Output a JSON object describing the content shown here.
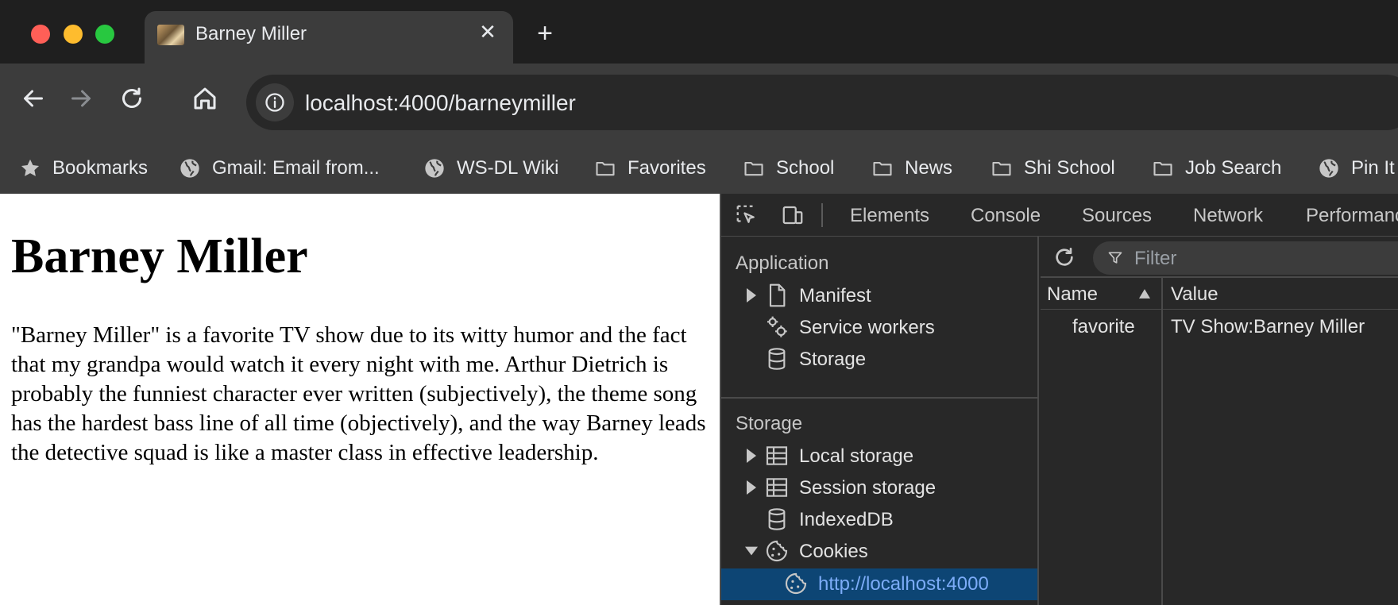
{
  "browser": {
    "tab": {
      "title": "Barney Miller",
      "close_glyph": "✕"
    },
    "new_tab_glyph": "+",
    "address": {
      "host": "localhost",
      "rest": ":4000/barneymiller"
    },
    "bookmarks": [
      {
        "label": "Bookmarks",
        "icon": "star-icon"
      },
      {
        "label": "Gmail: Email from...",
        "icon": "globe-icon"
      },
      {
        "label": "WS-DL Wiki",
        "icon": "globe-icon"
      },
      {
        "label": "Favorites",
        "icon": "folder-icon"
      },
      {
        "label": "School",
        "icon": "folder-icon"
      },
      {
        "label": "News",
        "icon": "folder-icon"
      },
      {
        "label": "Shi School",
        "icon": "folder-icon"
      },
      {
        "label": "Job Search",
        "icon": "folder-icon"
      },
      {
        "label": "Pin It",
        "icon": "globe-icon"
      }
    ]
  },
  "page": {
    "heading": "Barney Miller",
    "paragraph": "\"Barney Miller\" is a favorite TV show due to its witty humor and the fact that my grandpa would watch it every night with me. Arthur Dietrich is probably the funniest character ever written (subjectively), the theme song has the hardest bass line of all time (objectively), and the way Barney leads the detective squad is like a master class in effective leadership."
  },
  "devtools": {
    "tabs": [
      "Elements",
      "Console",
      "Sources",
      "Network",
      "Performance"
    ],
    "sidebar": {
      "application_header": "Application",
      "application_items": [
        "Manifest",
        "Service workers",
        "Storage"
      ],
      "storage_header": "Storage",
      "storage_items": [
        "Local storage",
        "Session storage",
        "IndexedDB",
        "Cookies"
      ],
      "selected_item": "http://localhost:4000"
    },
    "filter_placeholder": "Filter",
    "table": {
      "headers": {
        "name": "Name",
        "value": "Value"
      },
      "rows": [
        {
          "name": "favorite",
          "value": "TV Show:Barney Miller"
        }
      ]
    }
  },
  "colors": {
    "devtools_selected": "#0d4574",
    "selected_text": "#7cacf8",
    "traffic_red": "#ff5f57",
    "traffic_yellow": "#febc2e",
    "traffic_green": "#28c840"
  }
}
